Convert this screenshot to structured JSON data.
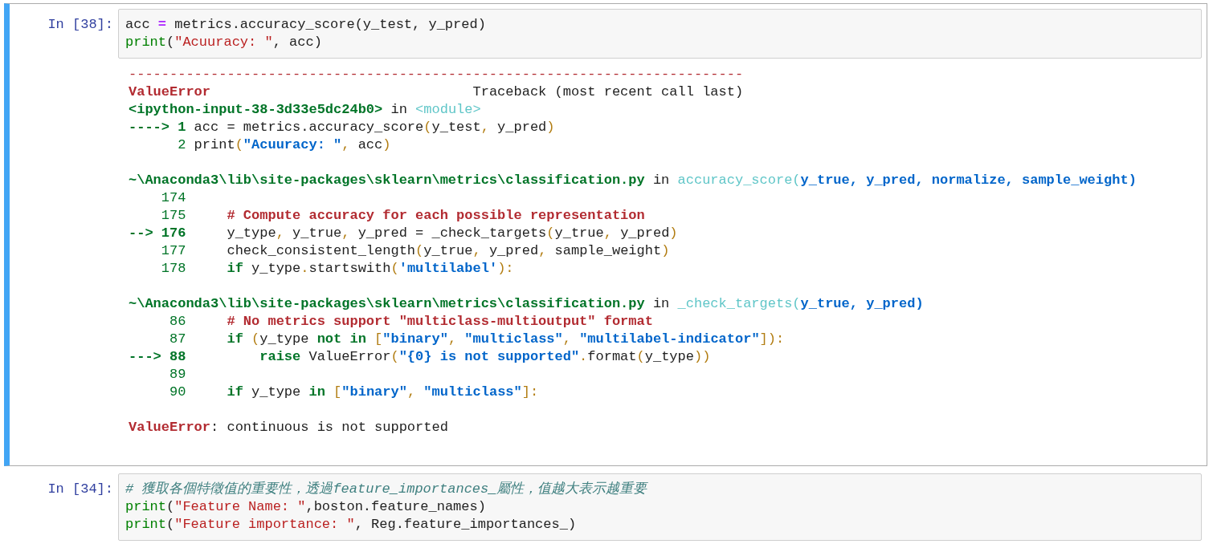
{
  "cells": [
    {
      "prompt": "In [38]:",
      "selected": true,
      "input": [
        {
          "tokens": [
            {
              "kind": "plain",
              "text": "acc "
            },
            {
              "kind": "operator",
              "text": "="
            },
            {
              "kind": "plain",
              "text": " metrics.accuracy_score(y_test, y_pred)"
            }
          ]
        },
        {
          "tokens": [
            {
              "kind": "builtin",
              "text": "print"
            },
            {
              "kind": "plain",
              "text": "("
            },
            {
              "kind": "string",
              "text": "\"Acuuracy: \""
            },
            {
              "kind": "plain",
              "text": ", acc)"
            }
          ]
        }
      ],
      "output": [
        {
          "lines": [
            {
              "tokens": [
                {
                  "kind": "tb_red",
                  "text": "---------------------------------------------------------------------------"
                }
              ]
            },
            {
              "tokens": [
                {
                  "kind": "tb_red_bold",
                  "text": "ValueError"
                },
                {
                  "kind": "plain",
                  "text": "                                Traceback (most recent call last)"
                }
              ]
            },
            {
              "tokens": [
                {
                  "kind": "tb_green_bold",
                  "text": "<ipython-input-38-3d33e5dc24b0>"
                },
                {
                  "kind": "plain",
                  "text": " in "
                },
                {
                  "kind": "tb_cyan",
                  "text": "<module>"
                }
              ]
            },
            {
              "tokens": [
                {
                  "kind": "tb_green_bold",
                  "text": "----> 1"
                },
                {
                  "kind": "plain",
                  "text": " acc = metrics.accuracy_score"
                },
                {
                  "kind": "tb_yellow",
                  "text": "("
                },
                {
                  "kind": "plain",
                  "text": "y_test"
                },
                {
                  "kind": "tb_yellow",
                  "text": ","
                },
                {
                  "kind": "plain",
                  "text": " y_pred"
                },
                {
                  "kind": "tb_yellow",
                  "text": ")"
                }
              ]
            },
            {
              "tokens": [
                {
                  "kind": "tb_green",
                  "text": "      2"
                },
                {
                  "kind": "plain",
                  "text": " print"
                },
                {
                  "kind": "tb_yellow",
                  "text": "("
                },
                {
                  "kind": "tb_blue_bold",
                  "text": "\"Acuuracy: \""
                },
                {
                  "kind": "tb_yellow",
                  "text": ","
                },
                {
                  "kind": "plain",
                  "text": " acc"
                },
                {
                  "kind": "tb_yellow",
                  "text": ")"
                }
              ]
            }
          ]
        },
        {
          "lines": [
            {
              "tokens": [
                {
                  "kind": "tb_green_bold",
                  "text": "~\\Anaconda3\\lib\\site-packages\\sklearn\\metrics\\classification.py"
                },
                {
                  "kind": "plain",
                  "text": " in "
                },
                {
                  "kind": "tb_cyan",
                  "text": "accuracy_score("
                },
                {
                  "kind": "tb_blue_bold",
                  "text": "y_true, y_pred, normalize, sample_weight)"
                }
              ]
            },
            {
              "tokens": [
                {
                  "kind": "tb_green",
                  "text": "    174"
                }
              ]
            },
            {
              "tokens": [
                {
                  "kind": "tb_green",
                  "text": "    175"
                },
                {
                  "kind": "tb_red_bold",
                  "text": "     # Compute accuracy for each possible representation"
                }
              ]
            },
            {
              "tokens": [
                {
                  "kind": "tb_green_bold",
                  "text": "--> 176"
                },
                {
                  "kind": "plain",
                  "text": "     y_type"
                },
                {
                  "kind": "tb_yellow",
                  "text": ","
                },
                {
                  "kind": "plain",
                  "text": " y_true"
                },
                {
                  "kind": "tb_yellow",
                  "text": ","
                },
                {
                  "kind": "plain",
                  "text": " y_pred = _check_targets"
                },
                {
                  "kind": "tb_yellow",
                  "text": "("
                },
                {
                  "kind": "plain",
                  "text": "y_true"
                },
                {
                  "kind": "tb_yellow",
                  "text": ","
                },
                {
                  "kind": "plain",
                  "text": " y_pred"
                },
                {
                  "kind": "tb_yellow",
                  "text": ")"
                }
              ]
            },
            {
              "tokens": [
                {
                  "kind": "tb_green",
                  "text": "    177"
                },
                {
                  "kind": "plain",
                  "text": "     check_consistent_length"
                },
                {
                  "kind": "tb_yellow",
                  "text": "("
                },
                {
                  "kind": "plain",
                  "text": "y_true"
                },
                {
                  "kind": "tb_yellow",
                  "text": ","
                },
                {
                  "kind": "plain",
                  "text": " y_pred"
                },
                {
                  "kind": "tb_yellow",
                  "text": ","
                },
                {
                  "kind": "plain",
                  "text": " sample_weight"
                },
                {
                  "kind": "tb_yellow",
                  "text": ")"
                }
              ]
            },
            {
              "tokens": [
                {
                  "kind": "tb_green",
                  "text": "    178"
                },
                {
                  "kind": "tb_green_bold",
                  "text": "     if"
                },
                {
                  "kind": "plain",
                  "text": " y_type"
                },
                {
                  "kind": "tb_yellow",
                  "text": "."
                },
                {
                  "kind": "plain",
                  "text": "startswith"
                },
                {
                  "kind": "tb_yellow",
                  "text": "("
                },
                {
                  "kind": "tb_blue_bold",
                  "text": "'multilabel'"
                },
                {
                  "kind": "tb_yellow",
                  "text": "):"
                }
              ]
            }
          ]
        },
        {
          "lines": [
            {
              "tokens": [
                {
                  "kind": "tb_green_bold",
                  "text": "~\\Anaconda3\\lib\\site-packages\\sklearn\\metrics\\classification.py"
                },
                {
                  "kind": "plain",
                  "text": " in "
                },
                {
                  "kind": "tb_cyan",
                  "text": "_check_targets("
                },
                {
                  "kind": "tb_blue_bold",
                  "text": "y_true, y_pred)"
                }
              ]
            },
            {
              "tokens": [
                {
                  "kind": "tb_green",
                  "text": "     86"
                },
                {
                  "kind": "tb_red_bold",
                  "text": "     # No metrics support \"multiclass-multioutput\" format"
                }
              ]
            },
            {
              "tokens": [
                {
                  "kind": "tb_green",
                  "text": "     87"
                },
                {
                  "kind": "tb_green_bold",
                  "text": "     if"
                },
                {
                  "kind": "tb_yellow",
                  "text": " ("
                },
                {
                  "kind": "plain",
                  "text": "y_type "
                },
                {
                  "kind": "tb_green_bold",
                  "text": "not in"
                },
                {
                  "kind": "tb_yellow",
                  "text": " ["
                },
                {
                  "kind": "tb_blue_bold",
                  "text": "\"binary\""
                },
                {
                  "kind": "tb_yellow",
                  "text": ","
                },
                {
                  "kind": "tb_blue_bold",
                  "text": " \"multiclass\""
                },
                {
                  "kind": "tb_yellow",
                  "text": ","
                },
                {
                  "kind": "tb_blue_bold",
                  "text": " \"multilabel-indicator\""
                },
                {
                  "kind": "tb_yellow",
                  "text": "]):"
                }
              ]
            },
            {
              "tokens": [
                {
                  "kind": "tb_green_bold",
                  "text": "---> 88"
                },
                {
                  "kind": "tb_green_bold",
                  "text": "         raise"
                },
                {
                  "kind": "plain",
                  "text": " ValueError"
                },
                {
                  "kind": "tb_yellow",
                  "text": "("
                },
                {
                  "kind": "tb_blue_bold",
                  "text": "\"{0} is not supported\""
                },
                {
                  "kind": "tb_yellow",
                  "text": "."
                },
                {
                  "kind": "plain",
                  "text": "format"
                },
                {
                  "kind": "tb_yellow",
                  "text": "("
                },
                {
                  "kind": "plain",
                  "text": "y_type"
                },
                {
                  "kind": "tb_yellow",
                  "text": "))"
                }
              ]
            },
            {
              "tokens": [
                {
                  "kind": "tb_green",
                  "text": "     89"
                }
              ]
            },
            {
              "tokens": [
                {
                  "kind": "tb_green",
                  "text": "     90"
                },
                {
                  "kind": "tb_green_bold",
                  "text": "     if"
                },
                {
                  "kind": "plain",
                  "text": " y_type "
                },
                {
                  "kind": "tb_green_bold",
                  "text": "in"
                },
                {
                  "kind": "tb_yellow",
                  "text": " ["
                },
                {
                  "kind": "tb_blue_bold",
                  "text": "\"binary\""
                },
                {
                  "kind": "tb_yellow",
                  "text": ","
                },
                {
                  "kind": "tb_blue_bold",
                  "text": " \"multiclass\""
                },
                {
                  "kind": "tb_yellow",
                  "text": "]:"
                }
              ]
            }
          ]
        },
        {
          "lines": [
            {
              "tokens": [
                {
                  "kind": "tb_red_bold",
                  "text": "ValueError"
                },
                {
                  "kind": "plain",
                  "text": ": continuous is not supported"
                }
              ]
            }
          ]
        }
      ]
    },
    {
      "prompt": "In [34]:",
      "selected": false,
      "input": [
        {
          "tokens": [
            {
              "kind": "comment",
              "text": "# 獲取各個特徵值的重要性，透過feature_importances_屬性，值越大表示越重要"
            }
          ]
        },
        {
          "tokens": [
            {
              "kind": "builtin",
              "text": "print"
            },
            {
              "kind": "plain",
              "text": "("
            },
            {
              "kind": "string",
              "text": "\"Feature Name: \""
            },
            {
              "kind": "plain",
              "text": ",boston.feature_names)"
            }
          ]
        },
        {
          "tokens": [
            {
              "kind": "builtin",
              "text": "print"
            },
            {
              "kind": "plain",
              "text": "("
            },
            {
              "kind": "string",
              "text": "\"Feature importance: \""
            },
            {
              "kind": "plain",
              "text": ", Reg.feature_importances_)"
            }
          ]
        }
      ]
    }
  ]
}
